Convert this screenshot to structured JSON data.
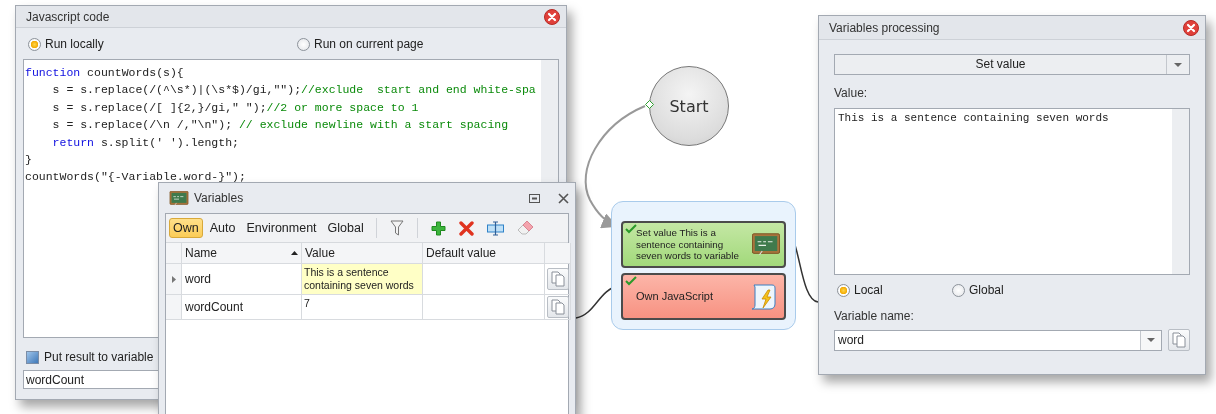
{
  "code_window": {
    "title": "Javascript code",
    "run_options": [
      {
        "label": "Run locally",
        "selected": true
      },
      {
        "label": "Run on current page",
        "selected": false
      }
    ],
    "code_lines": [
      [
        {
          "kind": "keyword",
          "text": "function"
        },
        {
          "kind": "plain",
          "text": " countWords(s){"
        }
      ],
      [
        {
          "kind": "plain",
          "text": "    s = s.replace(/(^\\s*)|(\\s*$)/gi,\"\");"
        },
        {
          "kind": "comment",
          "text": "//exclude  start and end white-spa"
        }
      ],
      [
        {
          "kind": "plain",
          "text": "    s = s.replace(/[ ]{2,}/gi,\" \");"
        },
        {
          "kind": "comment",
          "text": "//2 or more space to 1"
        }
      ],
      [
        {
          "kind": "plain",
          "text": "    s = s.replace(/\\n /,\"\\n\"); "
        },
        {
          "kind": "comment",
          "text": "// exclude newline with a start spacing"
        }
      ],
      [
        {
          "kind": "keyword",
          "text": "    return"
        },
        {
          "kind": "plain",
          "text": " s.split(' ').length;"
        }
      ],
      [
        {
          "kind": "plain",
          "text": "}"
        }
      ],
      [
        {
          "kind": "plain",
          "text": "countWords(\"{-Variable.word-}\");"
        }
      ]
    ],
    "result_option": {
      "label": "Put result to variable",
      "checked": true
    },
    "result_variable": "wordCount"
  },
  "variables_window": {
    "title": "Variables",
    "scopes": [
      {
        "label": "Own",
        "selected": true
      },
      {
        "label": "Auto",
        "selected": false
      },
      {
        "label": "Environment",
        "selected": false
      },
      {
        "label": "Global",
        "selected": false
      }
    ],
    "columns": [
      {
        "label": "Name",
        "sorted": true
      },
      {
        "label": "Value",
        "sorted": false
      },
      {
        "label": "Default value",
        "sorted": false
      }
    ],
    "rows": [
      {
        "name": "word",
        "value": "This is a sentence containing seven words",
        "selected": true
      },
      {
        "name": "wordCount",
        "value": "7",
        "selected": false
      }
    ]
  },
  "flow": {
    "start": {
      "label": "Start"
    },
    "nodes": [
      {
        "kind": "set-value",
        "label": "Set value This is a sentence containing seven words to variable",
        "checked": true
      },
      {
        "kind": "javascript",
        "label": "Own JavaScript",
        "checked": true
      }
    ]
  },
  "processing_window": {
    "title": "Variables processing",
    "operation": "Set value",
    "value_label": "Value:",
    "value": "This is a sentence containing seven words",
    "scopes": [
      {
        "label": "Local",
        "selected": true
      },
      {
        "label": "Global",
        "selected": false
      }
    ],
    "name_label": "Variable name:",
    "variable_name": "word"
  }
}
